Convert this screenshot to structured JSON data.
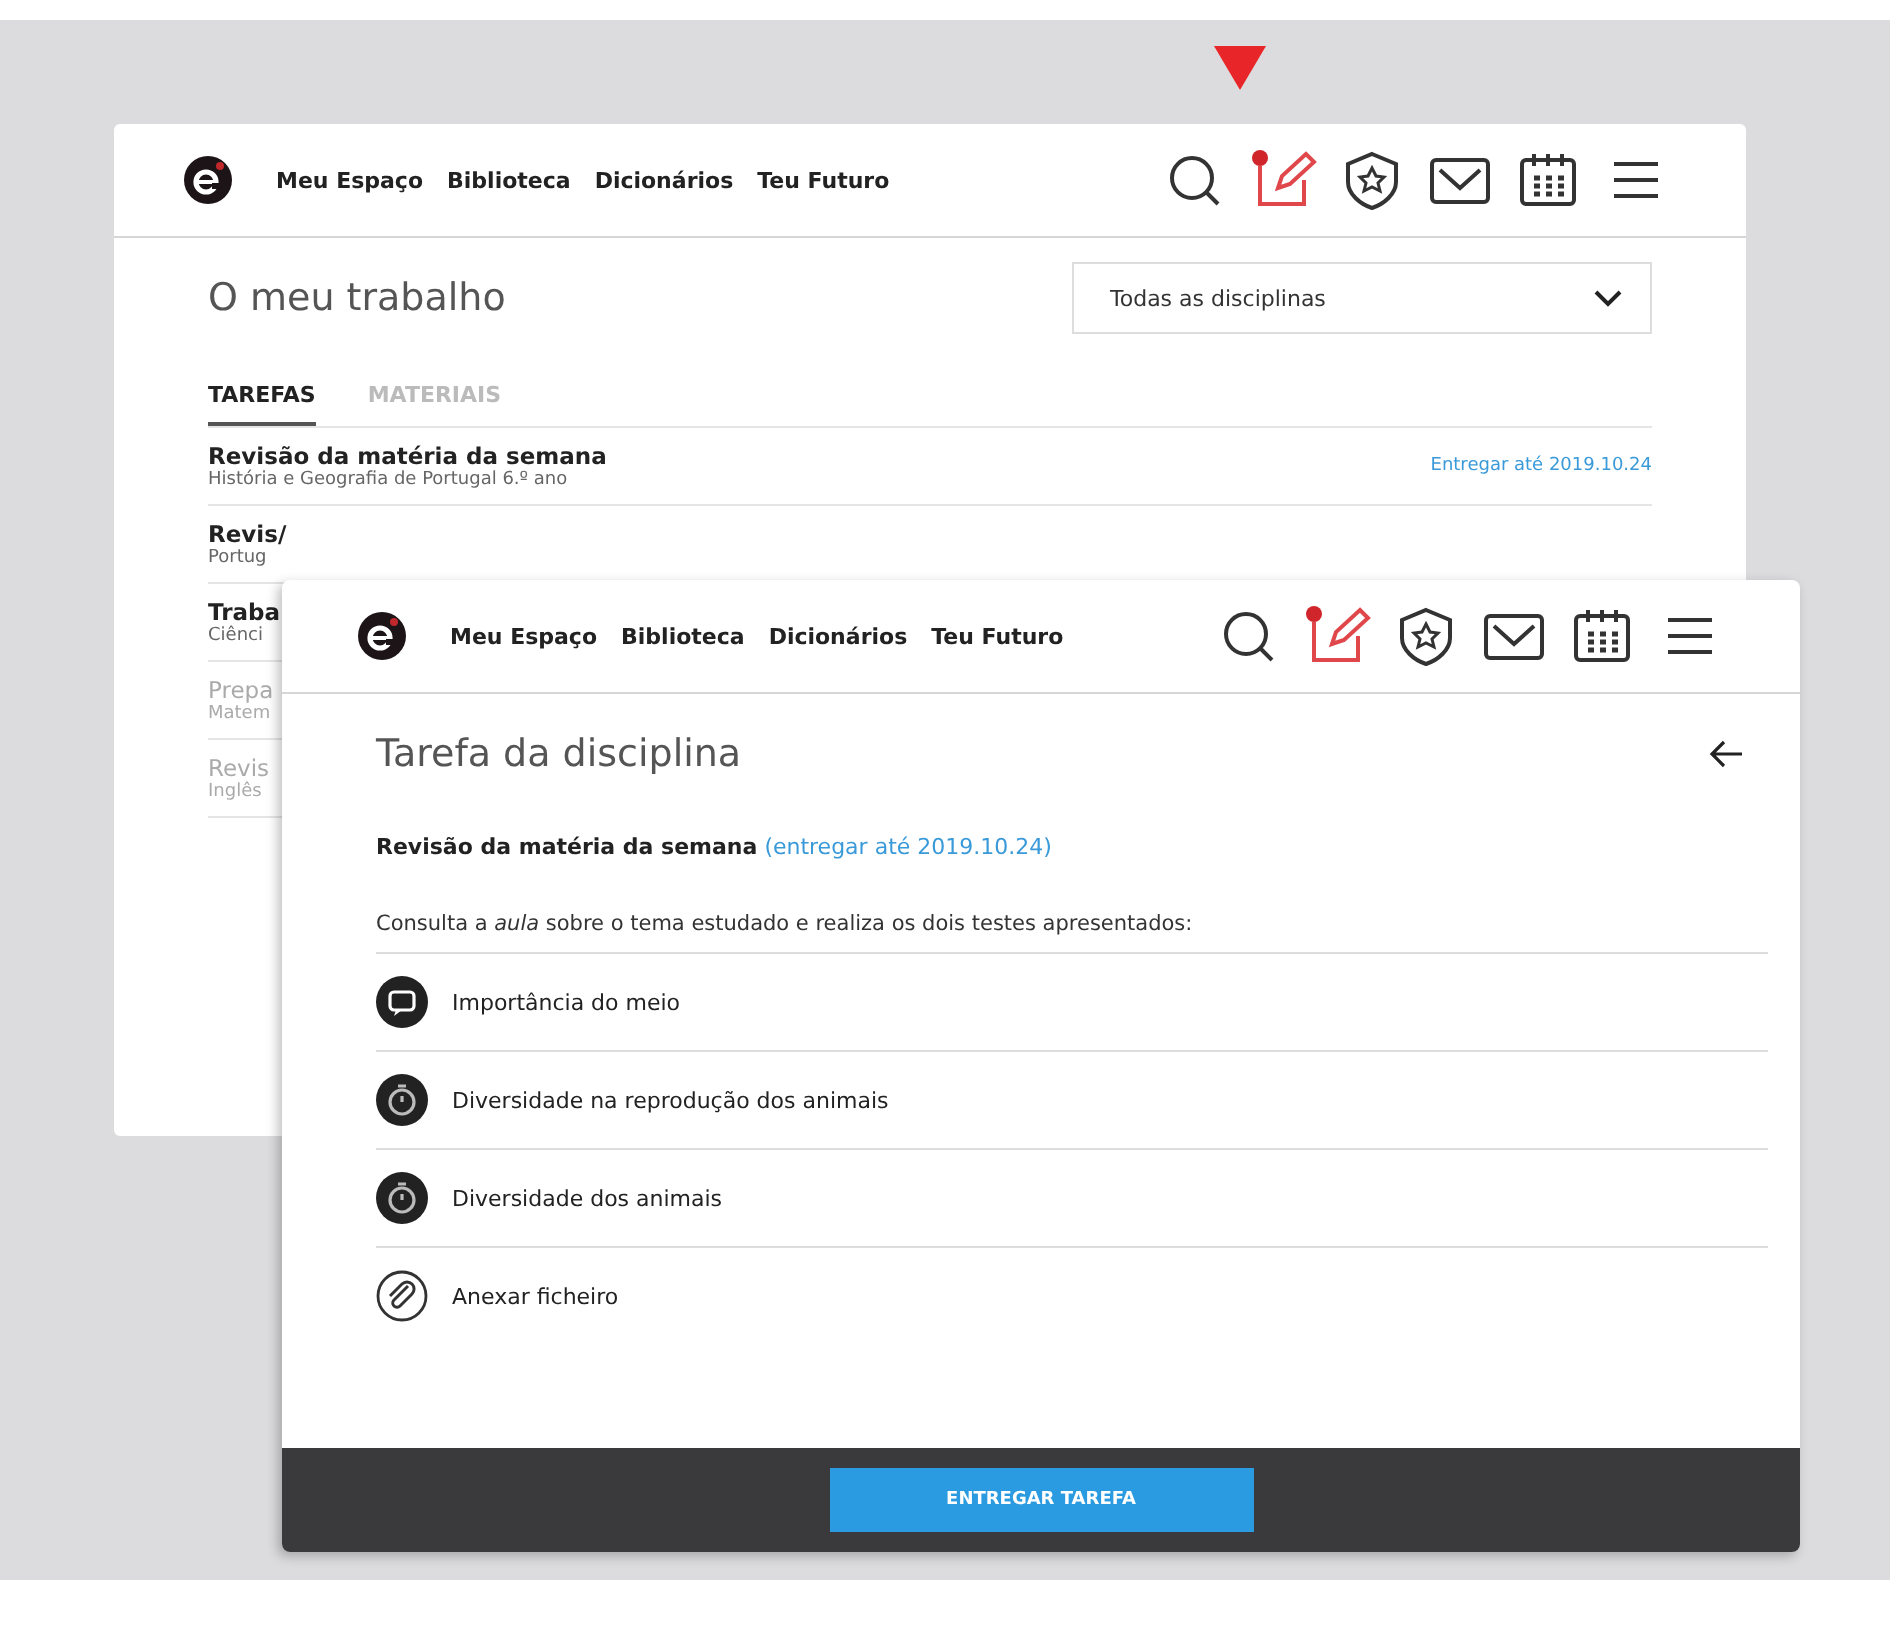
{
  "marker": {
    "kind": "pointer"
  },
  "back_window": {
    "nav": {
      "links": [
        {
          "label": "Meu Espaço"
        },
        {
          "label": "Biblioteca"
        },
        {
          "label": "Dicionários"
        },
        {
          "label": "Teu Futuro"
        }
      ],
      "icons": [
        {
          "kind": "search",
          "active": false,
          "badge": false
        },
        {
          "kind": "tasks",
          "active": true,
          "badge": true
        },
        {
          "kind": "badge",
          "active": false,
          "badge": false
        },
        {
          "kind": "mail",
          "active": false,
          "badge": false
        },
        {
          "kind": "calendar",
          "active": false,
          "badge": false
        },
        {
          "kind": "menu",
          "active": false,
          "badge": false
        }
      ]
    },
    "title": "O meu trabalho",
    "filter": {
      "value": "Todas as disciplinas"
    },
    "tabs": [
      {
        "label": "TAREFAS",
        "selected": true
      },
      {
        "label": "MATERIAIS",
        "selected": false
      }
    ],
    "tasks": [
      {
        "title": "Revisão da matéria da semana",
        "subject": "História e Geografia de Portugal 6.º ano",
        "due": "Entregar até 2019.10.24",
        "done": false
      },
      {
        "title": "Revis/",
        "subject": "Portug",
        "done": false
      },
      {
        "title": "Traba",
        "subject": "Ciênci",
        "done": false
      },
      {
        "title": "Prepa",
        "subject": "Matem",
        "done": true
      },
      {
        "title": "Revis",
        "subject": "Inglês",
        "done": true
      }
    ]
  },
  "front_window": {
    "nav": {
      "links": [
        {
          "label": "Meu Espaço"
        },
        {
          "label": "Biblioteca"
        },
        {
          "label": "Dicionários"
        },
        {
          "label": "Teu Futuro"
        }
      ],
      "icons": [
        {
          "kind": "search",
          "active": false,
          "badge": false
        },
        {
          "kind": "tasks",
          "active": true,
          "badge": true
        },
        {
          "kind": "badge",
          "active": false,
          "badge": false
        },
        {
          "kind": "mail",
          "active": false,
          "badge": false
        },
        {
          "kind": "calendar",
          "active": false,
          "badge": false
        },
        {
          "kind": "menu",
          "active": false,
          "badge": false
        }
      ]
    },
    "title": "Tarefa da disciplina",
    "task": {
      "title": "Revisão da matéria da semana",
      "due": "(entregar até 2019.10.24)"
    },
    "instruction": "Consulta a *aula* sobre o tema estudado e realiza os dois testes apresentados:",
    "items": [
      {
        "kind": "lesson",
        "label": "Importância do meio"
      },
      {
        "kind": "test",
        "label": "Diversidade na reprodução dos animais"
      },
      {
        "kind": "test",
        "label": "Diversidade dos animais"
      },
      {
        "kind": "attach",
        "label": "Anexar ficheiro"
      }
    ],
    "submit_button": "ENTREGAR TAREFA"
  }
}
